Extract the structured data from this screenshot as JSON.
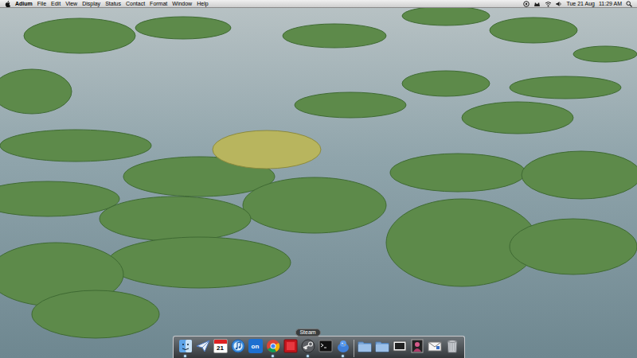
{
  "menu_bar": {
    "app": "Adium",
    "menus": [
      "File",
      "Edit",
      "View",
      "Display",
      "Status",
      "Contact",
      "Format",
      "Window",
      "Help"
    ],
    "clock": "Tue 21 Aug",
    "time": "11:29 AM"
  },
  "dock": {
    "tooltip": "Steam",
    "apps": [
      {
        "kind": "finder",
        "running": true,
        "hovered": false
      },
      {
        "kind": "mail",
        "running": false,
        "hovered": false
      },
      {
        "kind": "calendar",
        "label": "21",
        "running": false,
        "hovered": false
      },
      {
        "kind": "itunes",
        "running": false,
        "hovered": false
      },
      {
        "kind": "onlive",
        "label": "on",
        "running": false,
        "hovered": false
      },
      {
        "kind": "chrome",
        "running": true,
        "hovered": false
      },
      {
        "kind": "red",
        "running": false,
        "hovered": false
      },
      {
        "kind": "steam",
        "running": true,
        "hovered": true
      },
      {
        "kind": "terminal",
        "running": false,
        "hovered": false
      },
      {
        "kind": "adium",
        "running": true,
        "hovered": false
      }
    ],
    "stacks": [
      {
        "kind": "folder"
      },
      {
        "kind": "folder"
      },
      {
        "kind": "preview"
      },
      {
        "kind": "photo"
      },
      {
        "kind": "letter"
      },
      {
        "kind": "trash"
      }
    ]
  }
}
